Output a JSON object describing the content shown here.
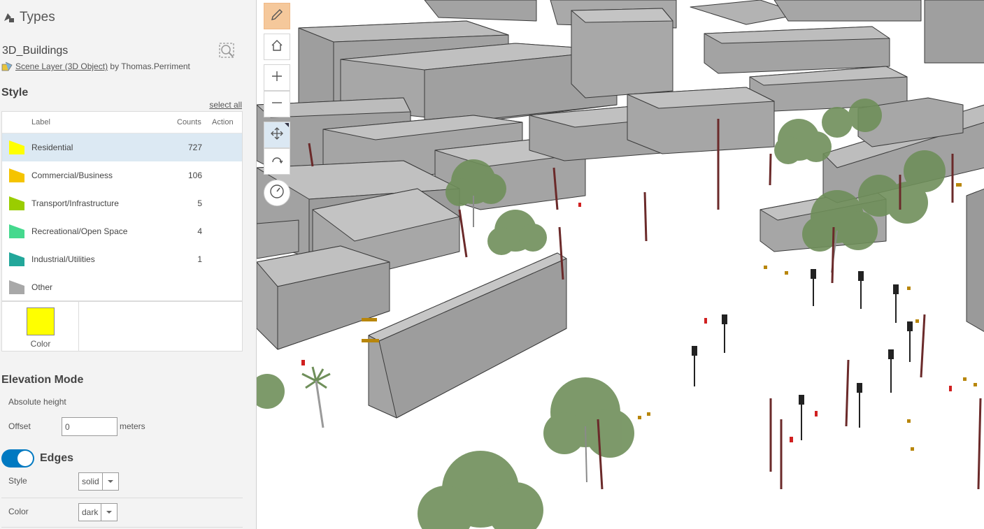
{
  "panel": {
    "header_title": "Types",
    "layer_title": "3D_Buildings",
    "layer_type_link": "Scene Layer (3D Object)",
    "layer_by": "by Thomas.Perriment",
    "style_heading": "Style",
    "select_all": "select all",
    "table": {
      "col_label": "Label",
      "col_counts": "Counts",
      "col_action": "Action",
      "rows": [
        {
          "label": "Residential",
          "count": "727",
          "color": "#ffff00",
          "selected": true
        },
        {
          "label": "Commercial/Business",
          "count": "106",
          "color": "#f5c400"
        },
        {
          "label": "Transport/Infrastructure",
          "count": "5",
          "color": "#9acd00"
        },
        {
          "label": "Recreational/Open Space",
          "count": "4",
          "color": "#45d98e"
        },
        {
          "label": "Industrial/Utilities",
          "count": "1",
          "color": "#22a79a"
        },
        {
          "label": "Other",
          "count": "",
          "color": "#a8a8a8"
        }
      ]
    },
    "color_label": "Color",
    "selected_color": "#ffff00",
    "elevation_heading": "Elevation Mode",
    "elevation_mode": "Absolute height",
    "offset_label": "Offset",
    "offset_value": "0",
    "offset_unit": "meters",
    "edges_label": "Edges",
    "edges_on": true,
    "edge_style_label": "Style",
    "edge_style_value": "solid",
    "edge_color_label": "Color",
    "edge_color_value": "dark"
  },
  "toolbar": {
    "icons": [
      "pencil-icon",
      "home-icon",
      "plus-icon",
      "minus-icon",
      "pan-icon",
      "rotate-icon",
      "compass-icon"
    ]
  },
  "scene": {
    "building_color": "#a6a6a6",
    "building_top_color": "#bdbdbd",
    "ground_color": "#ffffff",
    "tree_color": "#6f8f5a",
    "pole_color": "#6b2a2a"
  }
}
